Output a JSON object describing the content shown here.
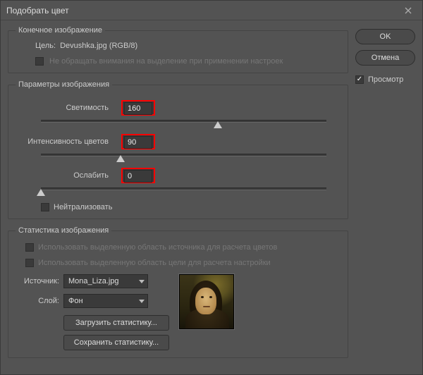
{
  "window": {
    "title": "Подобрать цвет"
  },
  "destination": {
    "legend": "Конечное изображение",
    "target_label": "Цель:",
    "target_value": "Devushka.jpg (RGB/8)",
    "ignore_selection_label": "Не обращать внимания на выделение при применении настроек",
    "ignore_selection_checked": false
  },
  "params": {
    "legend": "Параметры изображения",
    "luminance_label": "Светимость",
    "luminance_value": "160",
    "luminance_pos_pct": 62,
    "intensity_label": "Интенсивность цветов",
    "intensity_value": "90",
    "intensity_pos_pct": 28,
    "fade_label": "Ослабить",
    "fade_value": "0",
    "fade_pos_pct": 0,
    "neutralize_label": "Нейтрализовать",
    "neutralize_checked": false
  },
  "stats": {
    "legend": "Статистика изображения",
    "use_source_selection_label": "Использовать выделенную область источника для расчета цветов",
    "use_target_selection_label": "Использовать выделенную область цели для расчета настройки",
    "source_label": "Источник:",
    "source_value": "Mona_Liza.jpg",
    "layer_label": "Слой:",
    "layer_value": "Фон",
    "load_button": "Загрузить статистику...",
    "save_button": "Сохранить статистику..."
  },
  "buttons": {
    "ok": "OK",
    "cancel": "Отмена",
    "preview_label": "Просмотр",
    "preview_checked": true
  }
}
